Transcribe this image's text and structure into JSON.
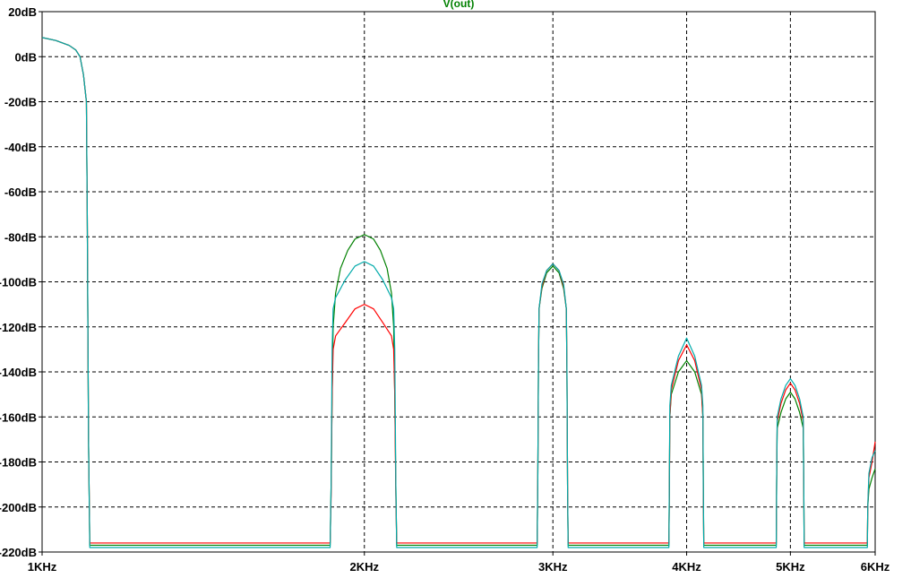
{
  "chart_data": {
    "type": "line",
    "title": "V(out)",
    "title_color": "#008000",
    "xscale": "log",
    "xlim": [
      1000,
      6000
    ],
    "ylim": [
      -220,
      20
    ],
    "grid": true,
    "x_ticks": [
      {
        "value": 1000,
        "label": "1KHz"
      },
      {
        "value": 2000,
        "label": "2KHz"
      },
      {
        "value": 3000,
        "label": "3KHz"
      },
      {
        "value": 4000,
        "label": "4KHz"
      },
      {
        "value": 5000,
        "label": "5KHz"
      },
      {
        "value": 6000,
        "label": "6KHz"
      }
    ],
    "y_ticks": [
      {
        "value": 20,
        "label": "20dB"
      },
      {
        "value": 0,
        "label": "0dB"
      },
      {
        "value": -20,
        "label": "-20dB"
      },
      {
        "value": -40,
        "label": "-40dB"
      },
      {
        "value": -60,
        "label": "-60dB"
      },
      {
        "value": -80,
        "label": "-80dB"
      },
      {
        "value": -100,
        "label": "-100dB"
      },
      {
        "value": -120,
        "label": "-120dB"
      },
      {
        "value": -140,
        "label": "-140dB"
      },
      {
        "value": -160,
        "label": "-160dB"
      },
      {
        "value": -180,
        "label": "-180dB"
      },
      {
        "value": -200,
        "label": "-200dB"
      },
      {
        "value": -220,
        "label": "-220dB"
      }
    ],
    "series": [
      {
        "color": "#008000",
        "values": [
          [
            1000,
            8.5
          ],
          [
            1030,
            7.2
          ],
          [
            1060,
            5
          ],
          [
            1075,
            3
          ],
          [
            1085,
            0
          ],
          [
            1093,
            -8
          ],
          [
            1100,
            -20
          ],
          [
            1102,
            -70
          ],
          [
            1105,
            -170
          ],
          [
            1108,
            -217
          ],
          [
            1858,
            -217
          ],
          [
            1862,
            -190
          ],
          [
            1866,
            -150
          ],
          [
            1870,
            -120
          ],
          [
            1880,
            -105
          ],
          [
            1900,
            -94
          ],
          [
            1930,
            -86
          ],
          [
            1960,
            -81
          ],
          [
            2000,
            -79
          ],
          [
            2040,
            -81
          ],
          [
            2070,
            -86
          ],
          [
            2100,
            -94
          ],
          [
            2120,
            -105
          ],
          [
            2130,
            -120
          ],
          [
            2135,
            -150
          ],
          [
            2140,
            -190
          ],
          [
            2144,
            -217
          ],
          [
            2900,
            -217
          ],
          [
            2904,
            -190
          ],
          [
            2908,
            -140
          ],
          [
            2912,
            -112
          ],
          [
            2930,
            -103
          ],
          [
            2960,
            -96
          ],
          [
            3000,
            -93
          ],
          [
            3040,
            -96
          ],
          [
            3070,
            -103
          ],
          [
            3088,
            -112
          ],
          [
            3092,
            -140
          ],
          [
            3096,
            -190
          ],
          [
            3100,
            -217
          ],
          [
            3850,
            -217
          ],
          [
            3854,
            -190
          ],
          [
            3858,
            -160
          ],
          [
            3870,
            -150
          ],
          [
            3930,
            -140
          ],
          [
            4000,
            -135
          ],
          [
            4070,
            -140
          ],
          [
            4130,
            -150
          ],
          [
            4142,
            -160
          ],
          [
            4146,
            -190
          ],
          [
            4150,
            -217
          ],
          [
            4850,
            -217
          ],
          [
            4854,
            -190
          ],
          [
            4860,
            -165
          ],
          [
            4900,
            -158
          ],
          [
            4950,
            -152
          ],
          [
            5000,
            -149
          ],
          [
            5050,
            -152
          ],
          [
            5100,
            -158
          ],
          [
            5140,
            -165
          ],
          [
            5146,
            -190
          ],
          [
            5150,
            -217
          ],
          [
            5900,
            -217
          ],
          [
            5905,
            -200
          ],
          [
            5920,
            -192
          ],
          [
            5960,
            -187
          ],
          [
            6000,
            -183
          ]
        ]
      },
      {
        "color": "#ff0000",
        "values": [
          [
            1000,
            8.5
          ],
          [
            1030,
            7.2
          ],
          [
            1060,
            5
          ],
          [
            1075,
            3
          ],
          [
            1085,
            0
          ],
          [
            1093,
            -8
          ],
          [
            1100,
            -20
          ],
          [
            1102,
            -70
          ],
          [
            1105,
            -170
          ],
          [
            1108,
            -216
          ],
          [
            1858,
            -216
          ],
          [
            1862,
            -195
          ],
          [
            1866,
            -150
          ],
          [
            1870,
            -130
          ],
          [
            1880,
            -124
          ],
          [
            1920,
            -118
          ],
          [
            1960,
            -112
          ],
          [
            2000,
            -110
          ],
          [
            2040,
            -112
          ],
          [
            2080,
            -118
          ],
          [
            2120,
            -124
          ],
          [
            2130,
            -130
          ],
          [
            2135,
            -150
          ],
          [
            2140,
            -195
          ],
          [
            2144,
            -216
          ],
          [
            2900,
            -216
          ],
          [
            2904,
            -190
          ],
          [
            2908,
            -140
          ],
          [
            2912,
            -112
          ],
          [
            2930,
            -102
          ],
          [
            2960,
            -95
          ],
          [
            3000,
            -92
          ],
          [
            3040,
            -95
          ],
          [
            3070,
            -102
          ],
          [
            3088,
            -112
          ],
          [
            3092,
            -140
          ],
          [
            3096,
            -190
          ],
          [
            3100,
            -216
          ],
          [
            3850,
            -216
          ],
          [
            3854,
            -195
          ],
          [
            3858,
            -160
          ],
          [
            3870,
            -148
          ],
          [
            3930,
            -135
          ],
          [
            4000,
            -128
          ],
          [
            4070,
            -135
          ],
          [
            4130,
            -148
          ],
          [
            4142,
            -160
          ],
          [
            4146,
            -195
          ],
          [
            4150,
            -216
          ],
          [
            4850,
            -216
          ],
          [
            4854,
            -190
          ],
          [
            4860,
            -162
          ],
          [
            4900,
            -154
          ],
          [
            4950,
            -148
          ],
          [
            5000,
            -145
          ],
          [
            5050,
            -148
          ],
          [
            5100,
            -154
          ],
          [
            5140,
            -162
          ],
          [
            5146,
            -190
          ],
          [
            5150,
            -216
          ],
          [
            5900,
            -216
          ],
          [
            5905,
            -200
          ],
          [
            5920,
            -187
          ],
          [
            5960,
            -180
          ],
          [
            6000,
            -171
          ]
        ]
      },
      {
        "color": "#00aaaa",
        "values": [
          [
            1000,
            8.5
          ],
          [
            1030,
            7.2
          ],
          [
            1060,
            5
          ],
          [
            1075,
            3
          ],
          [
            1085,
            0
          ],
          [
            1093,
            -8
          ],
          [
            1100,
            -20
          ],
          [
            1102,
            -70
          ],
          [
            1105,
            -170
          ],
          [
            1108,
            -218
          ],
          [
            1858,
            -218
          ],
          [
            1862,
            -190
          ],
          [
            1866,
            -130
          ],
          [
            1870,
            -112
          ],
          [
            1880,
            -107
          ],
          [
            1920,
            -99
          ],
          [
            1960,
            -93
          ],
          [
            2000,
            -91
          ],
          [
            2040,
            -93
          ],
          [
            2080,
            -99
          ],
          [
            2120,
            -107
          ],
          [
            2130,
            -112
          ],
          [
            2135,
            -130
          ],
          [
            2140,
            -190
          ],
          [
            2144,
            -218
          ],
          [
            2900,
            -218
          ],
          [
            2904,
            -190
          ],
          [
            2908,
            -140
          ],
          [
            2912,
            -112
          ],
          [
            2930,
            -101
          ],
          [
            2960,
            -95
          ],
          [
            3000,
            -92
          ],
          [
            3040,
            -95
          ],
          [
            3070,
            -101
          ],
          [
            3088,
            -112
          ],
          [
            3092,
            -140
          ],
          [
            3096,
            -190
          ],
          [
            3100,
            -218
          ],
          [
            3850,
            -218
          ],
          [
            3854,
            -190
          ],
          [
            3858,
            -155
          ],
          [
            3870,
            -146
          ],
          [
            3930,
            -133
          ],
          [
            4000,
            -125
          ],
          [
            4070,
            -133
          ],
          [
            4130,
            -146
          ],
          [
            4142,
            -155
          ],
          [
            4146,
            -190
          ],
          [
            4150,
            -218
          ],
          [
            4850,
            -218
          ],
          [
            4854,
            -190
          ],
          [
            4860,
            -160
          ],
          [
            4900,
            -152
          ],
          [
            4950,
            -146
          ],
          [
            5000,
            -143
          ],
          [
            5050,
            -146
          ],
          [
            5100,
            -152
          ],
          [
            5140,
            -160
          ],
          [
            5146,
            -190
          ],
          [
            5150,
            -218
          ],
          [
            5900,
            -218
          ],
          [
            5905,
            -200
          ],
          [
            5920,
            -185
          ],
          [
            5960,
            -178
          ],
          [
            6000,
            -175
          ]
        ]
      }
    ]
  }
}
